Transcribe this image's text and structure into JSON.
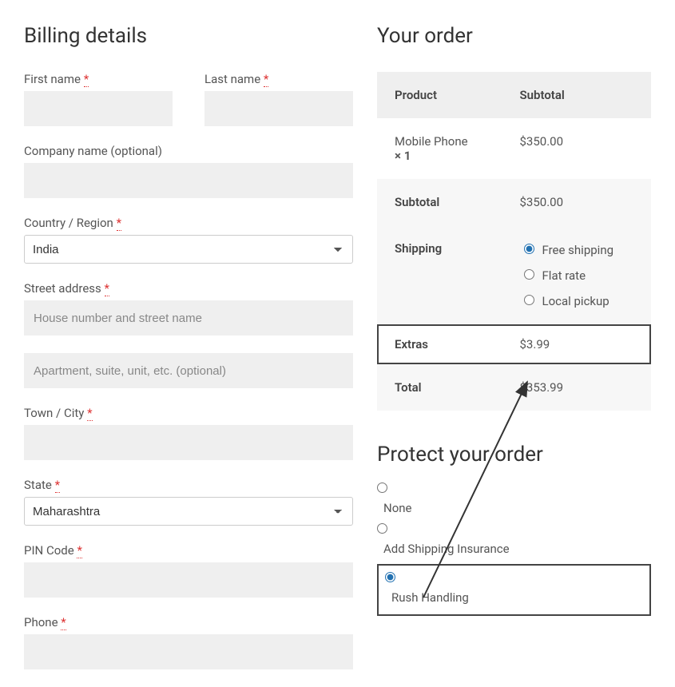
{
  "billing": {
    "heading": "Billing details",
    "first_name_label": "First name",
    "last_name_label": "Last name",
    "company_label": "Company name (optional)",
    "country_label": "Country / Region",
    "country_value": "India",
    "street_label": "Street address",
    "street_placeholder": "House number and street name",
    "apartment_placeholder": "Apartment, suite, unit, etc. (optional)",
    "town_label": "Town / City",
    "state_label": "State",
    "state_value": "Maharashtra",
    "pin_label": "PIN Code",
    "phone_label": "Phone"
  },
  "order": {
    "heading": "Your order",
    "col_product": "Product",
    "col_subtotal": "Subtotal",
    "item_name": "Mobile Phone",
    "item_qty": "× 1",
    "item_price": "$350.00",
    "subtotal_label": "Subtotal",
    "subtotal_value": "$350.00",
    "shipping_label": "Shipping",
    "shipping_options": [
      "Free shipping",
      "Flat rate",
      "Local pickup"
    ],
    "extras_label": "Extras",
    "extras_value": "$3.99",
    "total_label": "Total",
    "total_value": "$353.99"
  },
  "protect": {
    "heading": "Protect your order",
    "options": [
      "None",
      "Add Shipping Insurance",
      "Rush Handling"
    ]
  }
}
